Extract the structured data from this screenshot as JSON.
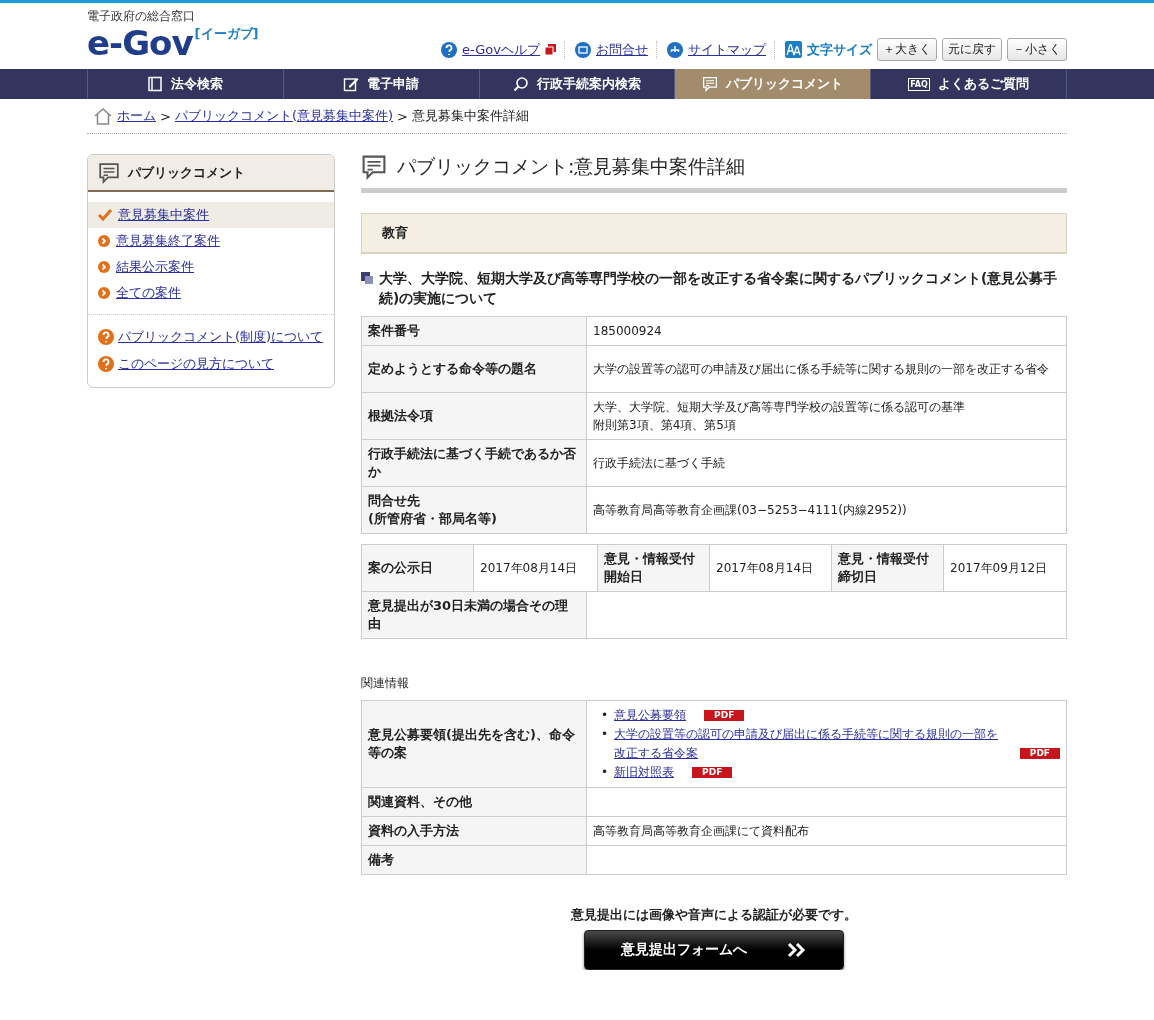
{
  "header": {
    "tagline": "電子政府の総合窓口",
    "logo": "e-Gov",
    "logo_sub": "[イーガブ]",
    "links": [
      {
        "label": "e-Govヘルプ",
        "kind": "help"
      },
      {
        "label": "お問合せ",
        "kind": "mail"
      },
      {
        "label": "サイトマップ",
        "kind": "sitemap"
      }
    ],
    "font_size_label": "文字サイズ",
    "font_buttons": [
      "＋大きく",
      "元に戻す",
      "－小さく"
    ]
  },
  "nav": [
    {
      "label": "法令検索",
      "selected": false
    },
    {
      "label": "電子申請",
      "selected": false
    },
    {
      "label": "行政手続案内検索",
      "selected": false
    },
    {
      "label": "パブリックコメント",
      "selected": true
    },
    {
      "label": "よくあるご質問",
      "selected": false,
      "badge": "FAQ"
    }
  ],
  "breadcrumb": {
    "separator": ">",
    "items": [
      "ホーム",
      "パブリックコメント(意見募集中案件)",
      "意見募集中案件詳細"
    ]
  },
  "sidebar": {
    "title": "パブリックコメント",
    "items": [
      {
        "label": "意見募集中案件",
        "selected": true
      },
      {
        "label": "意見募集終了案件",
        "selected": false
      },
      {
        "label": "結果公示案件",
        "selected": false
      },
      {
        "label": "全ての案件",
        "selected": false
      }
    ],
    "help_links": [
      "パブリックコメント(制度)について",
      "このページの見方について"
    ]
  },
  "main": {
    "title": "パブリックコメント:意見募集中案件詳細",
    "category": "教育",
    "case_title": "大学、大学院、短期大学及び高等専門学校の一部を改正する省令案に関するパブリックコメント(意見公募手続)の実施について",
    "details": [
      {
        "label": [
          "案件番号"
        ],
        "value": [
          "185000924"
        ]
      },
      {
        "label": [
          "定めようとする命令等の題名"
        ],
        "value": [
          "大学の設置等の認可の申請及び届出に係る手続等に関する規則の一部を改正する省令"
        ]
      },
      {
        "label": [
          "根拠法令項"
        ],
        "value": [
          "大学、大学院、短期大学及び高等専門学校の設置等に係る認可の基準",
          "附則第3項、第4項、第5項"
        ]
      },
      {
        "label": [
          "行政手続法に基づく手続であるか否か"
        ],
        "value": [
          "行政手続法に基づく手続"
        ]
      },
      {
        "label": [
          "問合せ先",
          "(所管府省・部局名等)"
        ],
        "value": [
          "高等教育局高等教育企画課(03−5253−4111(内線2952))"
        ]
      }
    ],
    "dates": [
      {
        "label": "案の公示日",
        "value": "2017年08月14日"
      },
      {
        "label": "意見・情報受付開始日",
        "value": "2017年08月14日"
      },
      {
        "label": "意見・情報受付締切日",
        "value": "2017年09月12日"
      }
    ],
    "reason": {
      "label": "意見提出が30日未満の場合その理由"
    },
    "related_heading": "関連情報",
    "related": [
      {
        "label": "意見公募要領(提出先を含む)、命令等の案",
        "kind": "links",
        "links": [
          {
            "marker": "•",
            "label": "意見公募要領",
            "badge": "PDF"
          },
          {
            "marker": "•",
            "label": "大学の設置等の認可の申請及び届出に係る手続等に関する規則の一部を改正する省令案",
            "badge": "PDF"
          },
          {
            "marker": "•",
            "label": "新旧対照表",
            "badge": "PDF"
          }
        ]
      },
      {
        "label": "関連資料、その他",
        "kind": "text"
      },
      {
        "label": "資料の入手方法",
        "kind": "text",
        "value": "高等教育局高等教育企画課にて資料配布"
      },
      {
        "label": "備考",
        "kind": "text"
      }
    ],
    "notice": "意見提出には画像や音声による認証が必要です。",
    "submit": "意見提出フォームへ"
  }
}
